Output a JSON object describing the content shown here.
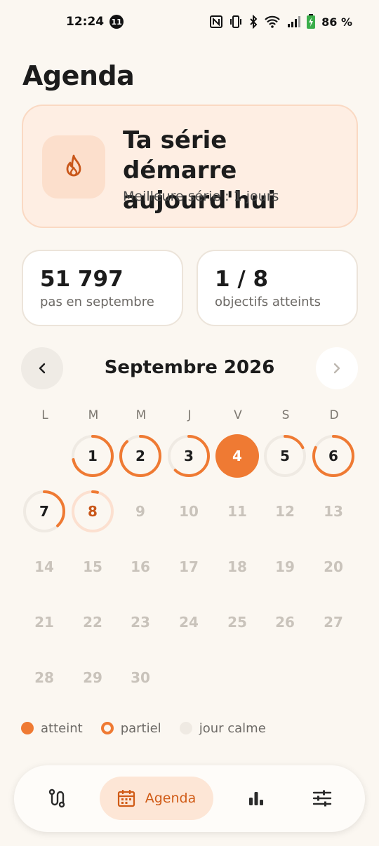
{
  "status": {
    "time": "12:24",
    "notification_count": "11",
    "battery": "86 %",
    "icons": [
      "nfc-icon",
      "vibrate-icon",
      "bluetooth-icon",
      "wifi-icon",
      "signal-icon",
      "battery-charging-icon"
    ]
  },
  "page": {
    "title": "Agenda"
  },
  "streak": {
    "title": "Ta série démarre aujourd'hui",
    "subtitle": "Meilleure série : 1 jours",
    "icon": "flame-icon"
  },
  "stats": [
    {
      "value": "51 797",
      "label": "pas en septembre"
    },
    {
      "value": "1 / 8",
      "label": "objectifs atteints"
    }
  ],
  "calendar": {
    "month_label": "Septembre 2026",
    "prev_icon": "chevron-left-icon",
    "next_icon": "chevron-right-icon",
    "weekdays": [
      "L",
      "M",
      "M",
      "J",
      "V",
      "S",
      "D"
    ],
    "days": [
      {
        "n": "1",
        "progress": 0.72
      },
      {
        "n": "2",
        "progress": 0.88
      },
      {
        "n": "3",
        "progress": 0.62
      },
      {
        "n": "4",
        "progress": 1.0,
        "reached": true
      },
      {
        "n": "5",
        "progress": 0.18
      },
      {
        "n": "6",
        "progress": 0.82
      },
      {
        "n": "7",
        "progress": 0.38
      },
      {
        "n": "8",
        "progress": 0.04,
        "today": true
      },
      {
        "n": "9"
      },
      {
        "n": "10"
      },
      {
        "n": "11"
      },
      {
        "n": "12"
      },
      {
        "n": "13"
      },
      {
        "n": "14"
      },
      {
        "n": "15"
      },
      {
        "n": "16"
      },
      {
        "n": "17"
      },
      {
        "n": "18"
      },
      {
        "n": "19"
      },
      {
        "n": "20"
      },
      {
        "n": "21"
      },
      {
        "n": "22"
      },
      {
        "n": "23"
      },
      {
        "n": "24"
      },
      {
        "n": "25"
      },
      {
        "n": "26"
      },
      {
        "n": "27"
      },
      {
        "n": "28"
      },
      {
        "n": "29"
      },
      {
        "n": "30"
      }
    ]
  },
  "legend": {
    "reached": "atteint",
    "partial": "partiel",
    "calm": "jour calme"
  },
  "bottom_nav": {
    "items": [
      {
        "name": "route",
        "icon": "route-icon"
      },
      {
        "name": "agenda",
        "icon": "calendar-icon",
        "label": "Agenda",
        "active": true
      },
      {
        "name": "stats",
        "icon": "bar-chart-icon"
      },
      {
        "name": "settings",
        "icon": "sliders-icon"
      }
    ]
  },
  "colors": {
    "accent": "#EF7A33",
    "accent_dark": "#C9571A",
    "ring_track": "#EFEAE3",
    "today_track": "#FCE0D0"
  }
}
